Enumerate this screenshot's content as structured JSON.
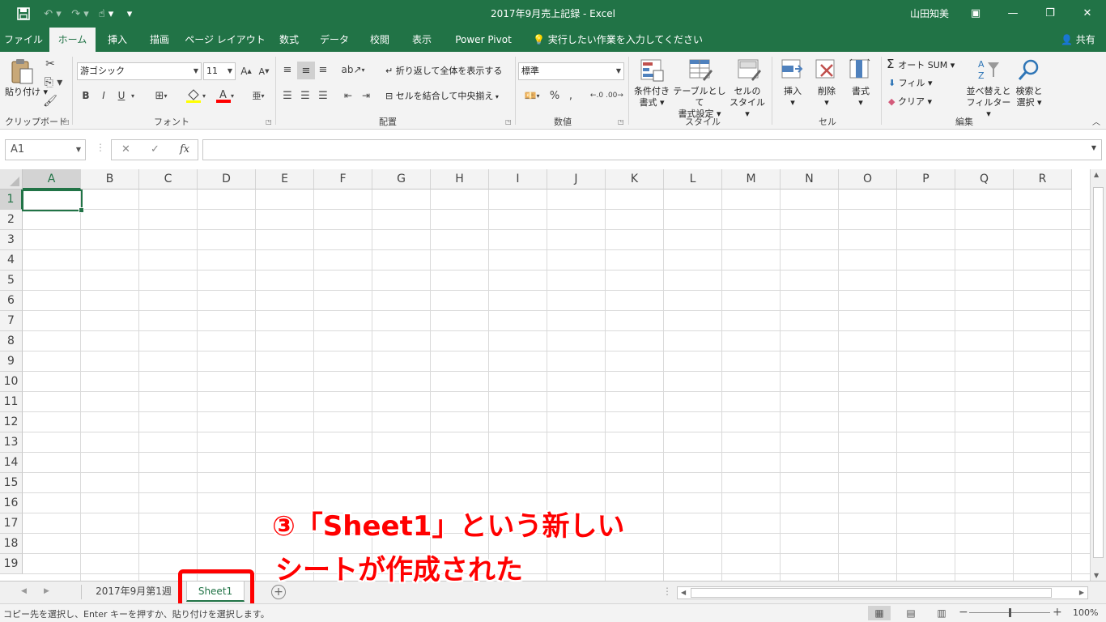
{
  "window": {
    "title": "2017年9月売上記録  -  Excel",
    "user": "山田知美",
    "quick_access": {
      "save_icon": "save-icon",
      "undo_icon": "undo-icon",
      "redo_icon": "redo-icon",
      "touch_icon": "touch-mode-icon",
      "customize_glyph": "▾"
    },
    "controls": {
      "ribbon_options": "▣",
      "minimize": "—",
      "restore": "❐",
      "close": "✕"
    }
  },
  "tabs": [
    {
      "label": "ファイル",
      "active": false
    },
    {
      "label": "ホーム",
      "active": true
    },
    {
      "label": "挿入",
      "active": false
    },
    {
      "label": "描画",
      "active": false
    },
    {
      "label": "ページ レイアウト",
      "active": false
    },
    {
      "label": "数式",
      "active": false
    },
    {
      "label": "データ",
      "active": false
    },
    {
      "label": "校閲",
      "active": false
    },
    {
      "label": "表示",
      "active": false
    },
    {
      "label": "Power Pivot",
      "active": false
    }
  ],
  "tell_me": "実行したい作業を入力してください",
  "share": "共有",
  "ribbon": {
    "clipboard": {
      "group": "クリップボード",
      "paste": "貼り付け"
    },
    "font": {
      "group": "フォント",
      "name": "游ゴシック",
      "size": "11",
      "bold": "B",
      "italic": "I",
      "underline": "U"
    },
    "alignment": {
      "group": "配置",
      "wrap": "折り返して全体を表示する",
      "merge": "セルを結合して中央揃え"
    },
    "number": {
      "group": "数値",
      "format": "標準"
    },
    "styles": {
      "group": "スタイル",
      "conditional_1": "条件付き",
      "conditional_2": "書式",
      "table_1": "テーブルとして",
      "table_2": "書式設定",
      "cell_1": "セルの",
      "cell_2": "スタイル"
    },
    "cells": {
      "group": "セル",
      "insert": "挿入",
      "delete": "削除",
      "format": "書式"
    },
    "editing": {
      "group": "編集",
      "autosum": "オート SUM",
      "fill": "フィル",
      "clear": "クリア",
      "sort_1": "並べ替えと",
      "sort_2": "フィルター",
      "find_1": "検索と",
      "find_2": "選択"
    }
  },
  "formula_bar": {
    "name_box": "A1",
    "cancel": "✕",
    "enter": "✓",
    "fx": "fx",
    "value": ""
  },
  "grid": {
    "columns": [
      "A",
      "B",
      "C",
      "D",
      "E",
      "F",
      "G",
      "H",
      "I",
      "J",
      "K",
      "L",
      "M",
      "N",
      "O",
      "P",
      "Q",
      "R"
    ],
    "rows": [
      "1",
      "2",
      "3",
      "4",
      "5",
      "6",
      "7",
      "8",
      "9",
      "10",
      "11",
      "12",
      "13",
      "14",
      "15",
      "16",
      "17",
      "18",
      "19"
    ],
    "selected_column": "A",
    "selected_row": "1"
  },
  "sheets": [
    {
      "name": "2017年9月第1週",
      "active": false
    },
    {
      "name": "Sheet1",
      "active": true
    }
  ],
  "add_sheet": "+",
  "annotation": {
    "line1": "③「Sheet1」という新しい",
    "line2": "シートが作成された",
    "color": "#ff0000"
  },
  "status": {
    "message": "コピー先を選択し、Enter キーを押すか、貼り付けを選択します。",
    "zoom": "100%",
    "zoom_out": "−",
    "zoom_in": "+"
  },
  "colors": {
    "accent": "#217346",
    "highlight": "#ff0000"
  }
}
